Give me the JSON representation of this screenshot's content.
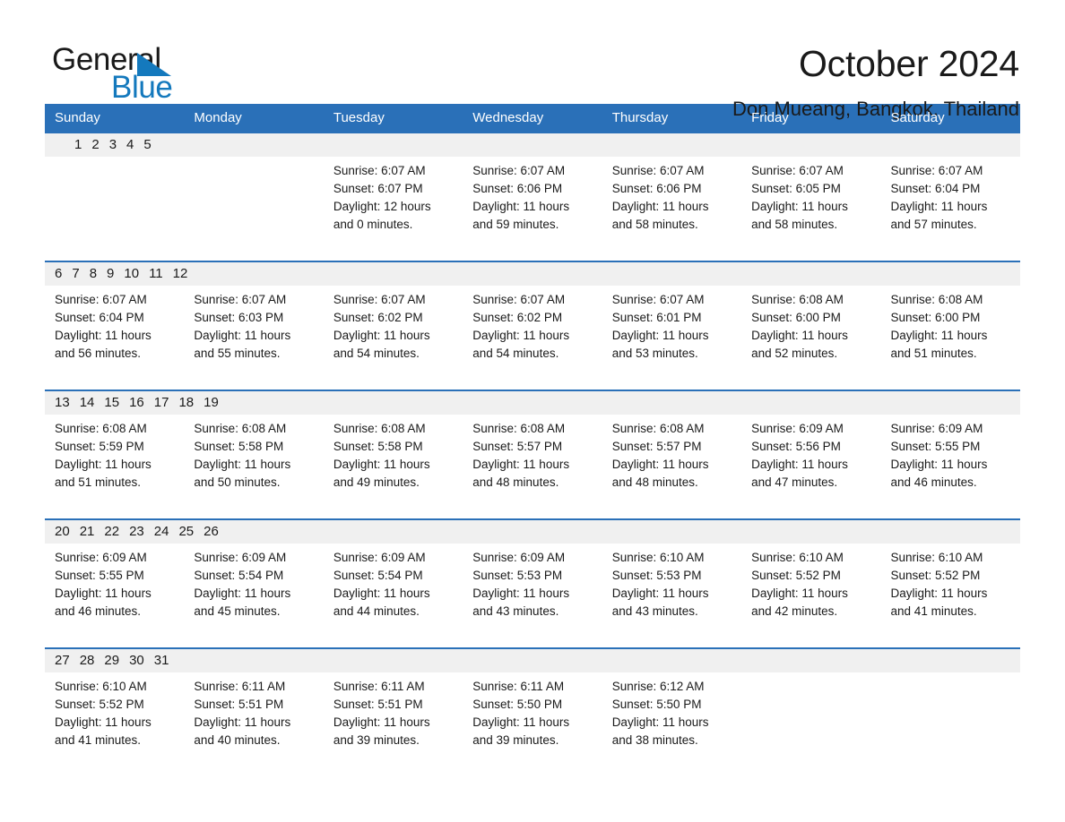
{
  "brand": {
    "name_part1": "General",
    "name_part2": "Blue",
    "triangle_color": "#1479bd",
    "text_color": "#1a1a1a"
  },
  "header": {
    "title": "October 2024",
    "subtitle": "Don Mueang, Bangkok, Thailand",
    "accent_color": "#2a70b8",
    "band_color": "#f0f0f0"
  },
  "weekday_headers": [
    "Sunday",
    "Monday",
    "Tuesday",
    "Wednesday",
    "Thursday",
    "Friday",
    "Saturday"
  ],
  "weeks": [
    [
      {
        "day": "",
        "sunrise": "",
        "sunset": "",
        "daylight_line1": "",
        "daylight_line2": ""
      },
      {
        "day": "",
        "sunrise": "",
        "sunset": "",
        "daylight_line1": "",
        "daylight_line2": ""
      },
      {
        "day": "1",
        "sunrise": "Sunrise: 6:07 AM",
        "sunset": "Sunset: 6:07 PM",
        "daylight_line1": "Daylight: 12 hours",
        "daylight_line2": "and 0 minutes."
      },
      {
        "day": "2",
        "sunrise": "Sunrise: 6:07 AM",
        "sunset": "Sunset: 6:06 PM",
        "daylight_line1": "Daylight: 11 hours",
        "daylight_line2": "and 59 minutes."
      },
      {
        "day": "3",
        "sunrise": "Sunrise: 6:07 AM",
        "sunset": "Sunset: 6:06 PM",
        "daylight_line1": "Daylight: 11 hours",
        "daylight_line2": "and 58 minutes."
      },
      {
        "day": "4",
        "sunrise": "Sunrise: 6:07 AM",
        "sunset": "Sunset: 6:05 PM",
        "daylight_line1": "Daylight: 11 hours",
        "daylight_line2": "and 58 minutes."
      },
      {
        "day": "5",
        "sunrise": "Sunrise: 6:07 AM",
        "sunset": "Sunset: 6:04 PM",
        "daylight_line1": "Daylight: 11 hours",
        "daylight_line2": "and 57 minutes."
      }
    ],
    [
      {
        "day": "6",
        "sunrise": "Sunrise: 6:07 AM",
        "sunset": "Sunset: 6:04 PM",
        "daylight_line1": "Daylight: 11 hours",
        "daylight_line2": "and 56 minutes."
      },
      {
        "day": "7",
        "sunrise": "Sunrise: 6:07 AM",
        "sunset": "Sunset: 6:03 PM",
        "daylight_line1": "Daylight: 11 hours",
        "daylight_line2": "and 55 minutes."
      },
      {
        "day": "8",
        "sunrise": "Sunrise: 6:07 AM",
        "sunset": "Sunset: 6:02 PM",
        "daylight_line1": "Daylight: 11 hours",
        "daylight_line2": "and 54 minutes."
      },
      {
        "day": "9",
        "sunrise": "Sunrise: 6:07 AM",
        "sunset": "Sunset: 6:02 PM",
        "daylight_line1": "Daylight: 11 hours",
        "daylight_line2": "and 54 minutes."
      },
      {
        "day": "10",
        "sunrise": "Sunrise: 6:07 AM",
        "sunset": "Sunset: 6:01 PM",
        "daylight_line1": "Daylight: 11 hours",
        "daylight_line2": "and 53 minutes."
      },
      {
        "day": "11",
        "sunrise": "Sunrise: 6:08 AM",
        "sunset": "Sunset: 6:00 PM",
        "daylight_line1": "Daylight: 11 hours",
        "daylight_line2": "and 52 minutes."
      },
      {
        "day": "12",
        "sunrise": "Sunrise: 6:08 AM",
        "sunset": "Sunset: 6:00 PM",
        "daylight_line1": "Daylight: 11 hours",
        "daylight_line2": "and 51 minutes."
      }
    ],
    [
      {
        "day": "13",
        "sunrise": "Sunrise: 6:08 AM",
        "sunset": "Sunset: 5:59 PM",
        "daylight_line1": "Daylight: 11 hours",
        "daylight_line2": "and 51 minutes."
      },
      {
        "day": "14",
        "sunrise": "Sunrise: 6:08 AM",
        "sunset": "Sunset: 5:58 PM",
        "daylight_line1": "Daylight: 11 hours",
        "daylight_line2": "and 50 minutes."
      },
      {
        "day": "15",
        "sunrise": "Sunrise: 6:08 AM",
        "sunset": "Sunset: 5:58 PM",
        "daylight_line1": "Daylight: 11 hours",
        "daylight_line2": "and 49 minutes."
      },
      {
        "day": "16",
        "sunrise": "Sunrise: 6:08 AM",
        "sunset": "Sunset: 5:57 PM",
        "daylight_line1": "Daylight: 11 hours",
        "daylight_line2": "and 48 minutes."
      },
      {
        "day": "17",
        "sunrise": "Sunrise: 6:08 AM",
        "sunset": "Sunset: 5:57 PM",
        "daylight_line1": "Daylight: 11 hours",
        "daylight_line2": "and 48 minutes."
      },
      {
        "day": "18",
        "sunrise": "Sunrise: 6:09 AM",
        "sunset": "Sunset: 5:56 PM",
        "daylight_line1": "Daylight: 11 hours",
        "daylight_line2": "and 47 minutes."
      },
      {
        "day": "19",
        "sunrise": "Sunrise: 6:09 AM",
        "sunset": "Sunset: 5:55 PM",
        "daylight_line1": "Daylight: 11 hours",
        "daylight_line2": "and 46 minutes."
      }
    ],
    [
      {
        "day": "20",
        "sunrise": "Sunrise: 6:09 AM",
        "sunset": "Sunset: 5:55 PM",
        "daylight_line1": "Daylight: 11 hours",
        "daylight_line2": "and 46 minutes."
      },
      {
        "day": "21",
        "sunrise": "Sunrise: 6:09 AM",
        "sunset": "Sunset: 5:54 PM",
        "daylight_line1": "Daylight: 11 hours",
        "daylight_line2": "and 45 minutes."
      },
      {
        "day": "22",
        "sunrise": "Sunrise: 6:09 AM",
        "sunset": "Sunset: 5:54 PM",
        "daylight_line1": "Daylight: 11 hours",
        "daylight_line2": "and 44 minutes."
      },
      {
        "day": "23",
        "sunrise": "Sunrise: 6:09 AM",
        "sunset": "Sunset: 5:53 PM",
        "daylight_line1": "Daylight: 11 hours",
        "daylight_line2": "and 43 minutes."
      },
      {
        "day": "24",
        "sunrise": "Sunrise: 6:10 AM",
        "sunset": "Sunset: 5:53 PM",
        "daylight_line1": "Daylight: 11 hours",
        "daylight_line2": "and 43 minutes."
      },
      {
        "day": "25",
        "sunrise": "Sunrise: 6:10 AM",
        "sunset": "Sunset: 5:52 PM",
        "daylight_line1": "Daylight: 11 hours",
        "daylight_line2": "and 42 minutes."
      },
      {
        "day": "26",
        "sunrise": "Sunrise: 6:10 AM",
        "sunset": "Sunset: 5:52 PM",
        "daylight_line1": "Daylight: 11 hours",
        "daylight_line2": "and 41 minutes."
      }
    ],
    [
      {
        "day": "27",
        "sunrise": "Sunrise: 6:10 AM",
        "sunset": "Sunset: 5:52 PM",
        "daylight_line1": "Daylight: 11 hours",
        "daylight_line2": "and 41 minutes."
      },
      {
        "day": "28",
        "sunrise": "Sunrise: 6:11 AM",
        "sunset": "Sunset: 5:51 PM",
        "daylight_line1": "Daylight: 11 hours",
        "daylight_line2": "and 40 minutes."
      },
      {
        "day": "29",
        "sunrise": "Sunrise: 6:11 AM",
        "sunset": "Sunset: 5:51 PM",
        "daylight_line1": "Daylight: 11 hours",
        "daylight_line2": "and 39 minutes."
      },
      {
        "day": "30",
        "sunrise": "Sunrise: 6:11 AM",
        "sunset": "Sunset: 5:50 PM",
        "daylight_line1": "Daylight: 11 hours",
        "daylight_line2": "and 39 minutes."
      },
      {
        "day": "31",
        "sunrise": "Sunrise: 6:12 AM",
        "sunset": "Sunset: 5:50 PM",
        "daylight_line1": "Daylight: 11 hours",
        "daylight_line2": "and 38 minutes."
      },
      {
        "day": "",
        "sunrise": "",
        "sunset": "",
        "daylight_line1": "",
        "daylight_line2": ""
      },
      {
        "day": "",
        "sunrise": "",
        "sunset": "",
        "daylight_line1": "",
        "daylight_line2": ""
      }
    ]
  ]
}
